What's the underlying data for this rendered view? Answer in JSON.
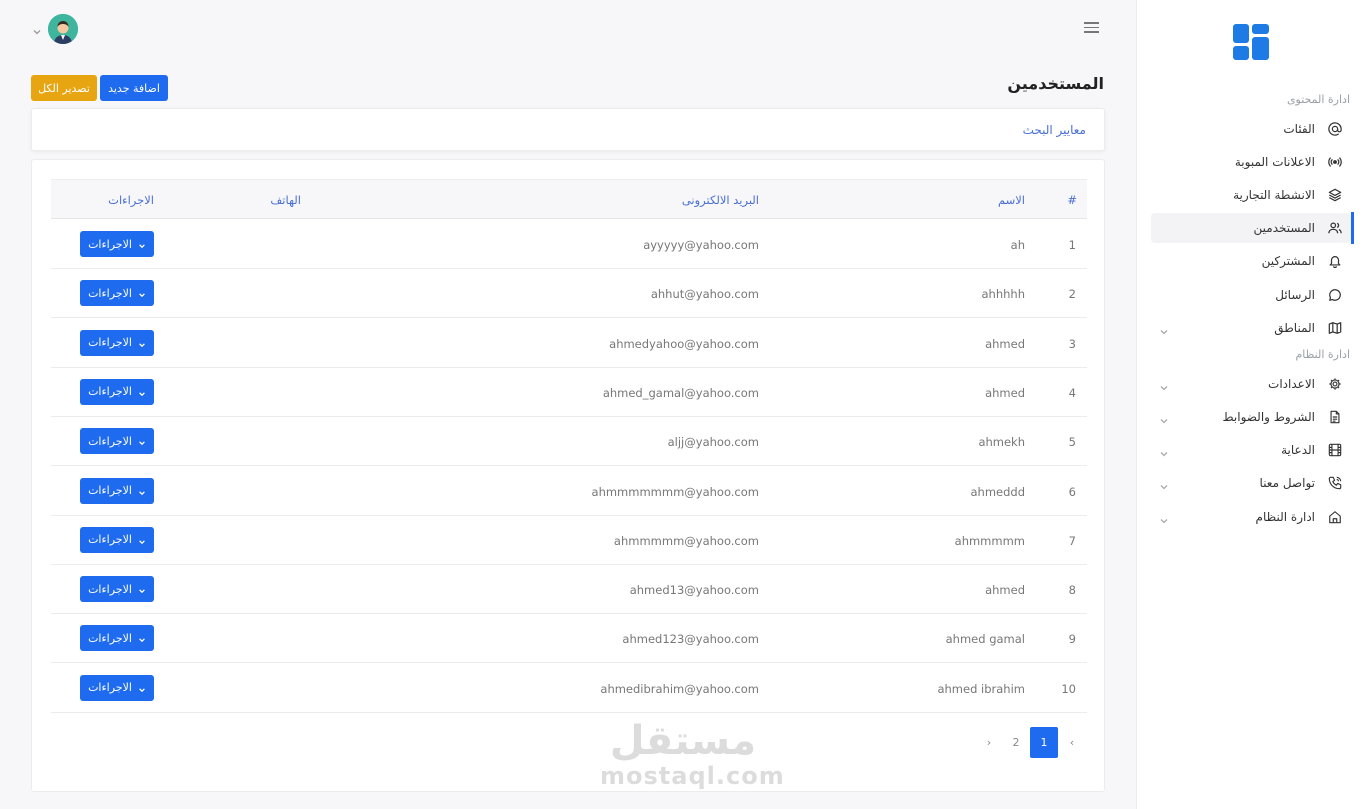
{
  "sidebar": {
    "content_section": "ادارة المحتوى",
    "system_section": "ادارة النظام",
    "items": [
      {
        "label": "الفئات",
        "icon": "at-icon"
      },
      {
        "label": "الاعلانات المبوبة",
        "icon": "broadcast-icon"
      },
      {
        "label": "الانشطة التجارية",
        "icon": "layers-icon"
      },
      {
        "label": "المستخدمين",
        "icon": "users-icon"
      },
      {
        "label": "المشتركين",
        "icon": "bell-icon"
      },
      {
        "label": "الرسائل",
        "icon": "message-icon"
      },
      {
        "label": "المناطق",
        "icon": "map-icon"
      },
      {
        "label": "الاعدادات",
        "icon": "gear-icon"
      },
      {
        "label": "الشروط والضوابط",
        "icon": "document-icon"
      },
      {
        "label": "الدعاية",
        "icon": "film-icon"
      },
      {
        "label": "تواصل معنا",
        "icon": "phone-icon"
      },
      {
        "label": "ادارة النظام",
        "icon": "home-icon"
      }
    ]
  },
  "page": {
    "title": "المستخدمين",
    "add_label": "اضافة جديد",
    "export_label": "تصدير الكل",
    "search_label": "معايير البحث"
  },
  "table": {
    "headers": {
      "num": "#",
      "name": "الاسم",
      "email": "البريد الالكترونى",
      "phone": "الهاتف",
      "actions": "الاجراءات"
    },
    "action_label": "الاجراءات",
    "rows": [
      {
        "num": "1",
        "name": "ah",
        "email": "ayyyyy@yahoo.com",
        "phone": ""
      },
      {
        "num": "2",
        "name": "ahhhhh",
        "email": "ahhut@yahoo.com",
        "phone": ""
      },
      {
        "num": "3",
        "name": "ahmed",
        "email": "ahmedyahoo@yahoo.com",
        "phone": ""
      },
      {
        "num": "4",
        "name": "ahmed",
        "email": "ahmed_gamal@yahoo.com",
        "phone": ""
      },
      {
        "num": "5",
        "name": "ahmekh",
        "email": "aljj@yahoo.com",
        "phone": ""
      },
      {
        "num": "6",
        "name": "ahmeddd",
        "email": "ahmmmmmmm@yahoo.com",
        "phone": ""
      },
      {
        "num": "7",
        "name": "ahmmmmm",
        "email": "ahmmmmm@yahoo.com",
        "phone": ""
      },
      {
        "num": "8",
        "name": "ahmed",
        "email": "ahmed13@yahoo.com",
        "phone": ""
      },
      {
        "num": "9",
        "name": "ahmed gamal",
        "email": "ahmed123@yahoo.com",
        "phone": ""
      },
      {
        "num": "10",
        "name": "ahmed ibrahim",
        "email": "ahmedibrahim@yahoo.com",
        "phone": ""
      }
    ]
  },
  "pagination": {
    "prev": "‹",
    "next": "›",
    "pages": [
      "1",
      "2"
    ],
    "current": "1"
  },
  "watermark": {
    "arabic": "مستقل",
    "latin": "mostaql.com"
  },
  "colors": {
    "primary": "#1e6bef",
    "warning": "#e8a512",
    "logo": "#1e7be6",
    "header_text": "#4a6fd3"
  }
}
